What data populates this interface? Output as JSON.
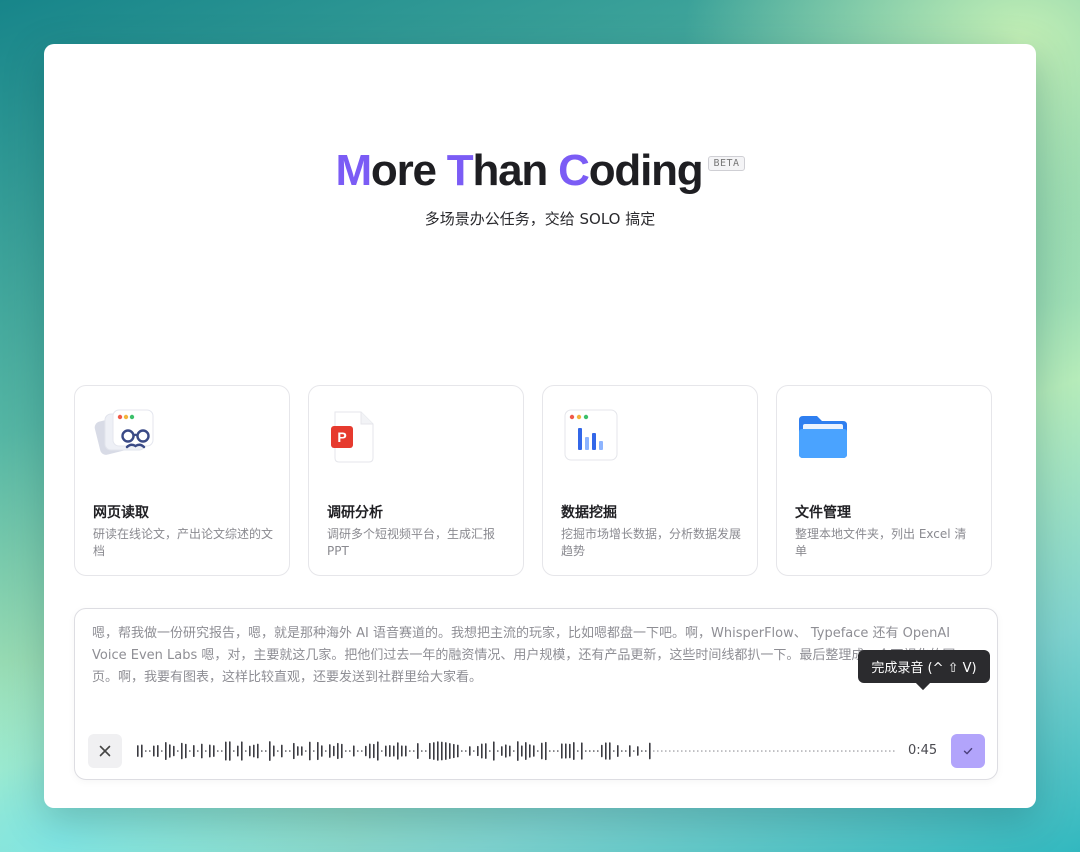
{
  "hero": {
    "title_parts": {
      "m": "M",
      "ore": "ore ",
      "t": "T",
      "han": "han ",
      "c": "C",
      "oding": "oding"
    },
    "beta_badge": "BETA",
    "subtitle": "多场景办公任务，交给 SOLO 搞定"
  },
  "cards": [
    {
      "icon": "web-reading-glasses-icon",
      "title": "网页读取",
      "description": "研读在线论文，产出论文综述的文档"
    },
    {
      "icon": "ppt-file-icon",
      "title": "调研分析",
      "description": "调研多个短视频平台，生成汇报 PPT"
    },
    {
      "icon": "bar-chart-icon",
      "title": "数据挖掘",
      "description": "挖掘市场增长数据，分析数据发展趋势"
    },
    {
      "icon": "folder-icon",
      "title": "文件管理",
      "description": "整理本地文件夹，列出 Excel 清单"
    }
  ],
  "voice_input": {
    "transcript": "嗯，帮我做一份研究报告，嗯，就是那种海外 AI 语音赛道的。我想把主流的玩家，比如嗯都盘一下吧。啊，WhisperFlow、 Typeface 还有 OpenAI Voice  Even Labs 嗯，对，主要就这几家。把他们过去一年的融资情况、用户规模，还有产品更新，这些时间线都扒一下。最后整理成一个可视化的网页。啊，我要有图表，这样比较直观，还要发送到社群里给大家看。",
    "elapsed": "0:45",
    "tooltip": "完成录音 (^ ⇧ V)"
  },
  "colors": {
    "accent": "#7b5cf5",
    "done_button": "#b2a4fb",
    "tooltip_bg": "#2b2b2e",
    "ppt_red": "#e63a2e",
    "folder_blue": "#4aa3ff"
  }
}
